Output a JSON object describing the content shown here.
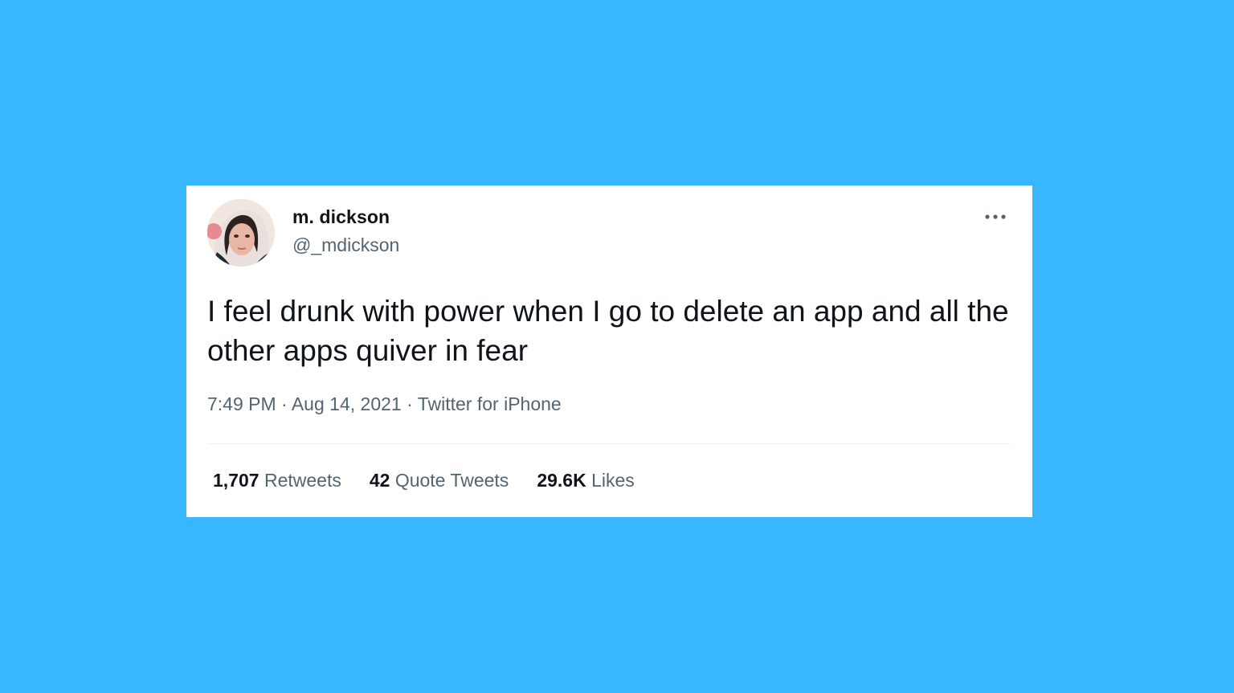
{
  "tweet": {
    "author": {
      "display_name": "m. dickson",
      "handle": "@_mdickson"
    },
    "text": "I feel drunk with power when I go to delete an app and all the other apps quiver in fear",
    "time": "7:49 PM",
    "date": "Aug 14, 2021",
    "source": "Twitter for iPhone",
    "separator": "·",
    "stats": {
      "retweets_count": "1,707",
      "retweets_label": "Retweets",
      "quotes_count": "42",
      "quotes_label": "Quote Tweets",
      "likes_count": "29.6K",
      "likes_label": "Likes"
    }
  },
  "icons": {
    "more": "more-options-icon",
    "avatar": "avatar-photo"
  },
  "colors": {
    "background": "#38b6ff",
    "card": "#ffffff",
    "text_primary": "#0f1419",
    "text_secondary": "#536471",
    "divider": "#eff3f4"
  }
}
